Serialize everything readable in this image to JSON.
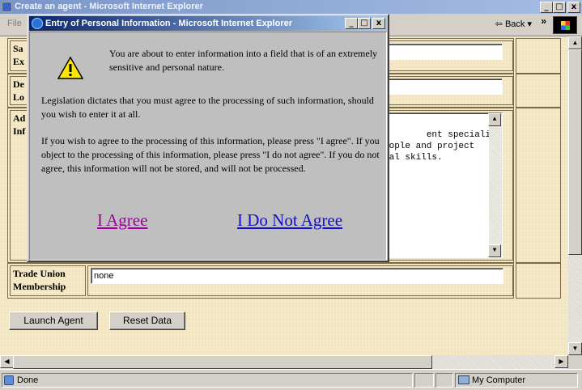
{
  "main_window": {
    "title": "Create an agent - Microsoft Internet Explorer",
    "menu_file": "File",
    "back_label": "Back",
    "min_glyph": "_",
    "max_glyph": "□",
    "close_glyph": "x"
  },
  "form": {
    "row1_label": "Sa\nEx",
    "row2_label": "De\nLo",
    "row3_label": "Ad\nInf",
    "additional_info_text": "ent specialist,\neople and project\ncal skills.",
    "trade_union_label": "Trade Union Membership",
    "trade_union_value": "none"
  },
  "buttons": {
    "launch": "Launch Agent",
    "reset": "Reset Data"
  },
  "status": {
    "left": "Done",
    "zone": "My Computer"
  },
  "dialog": {
    "title": "Entry of Personal Information - Microsoft Internet Explorer",
    "para1": "You are about to enter information into a field that is of an extremely sensitive and personal nature.",
    "para2": "Legislation dictates that you must agree to the processing of such information, should you wish to enter it at all.",
    "para3": "If you wish to agree to the processing of this information, please press \"I agree\". If you object to the processing of this information, please press \"I do not agree\". If you do not agree, this information will not be stored, and will not be processed.",
    "agree_label": "I Agree",
    "disagree_label": "I Do Not Agree"
  }
}
